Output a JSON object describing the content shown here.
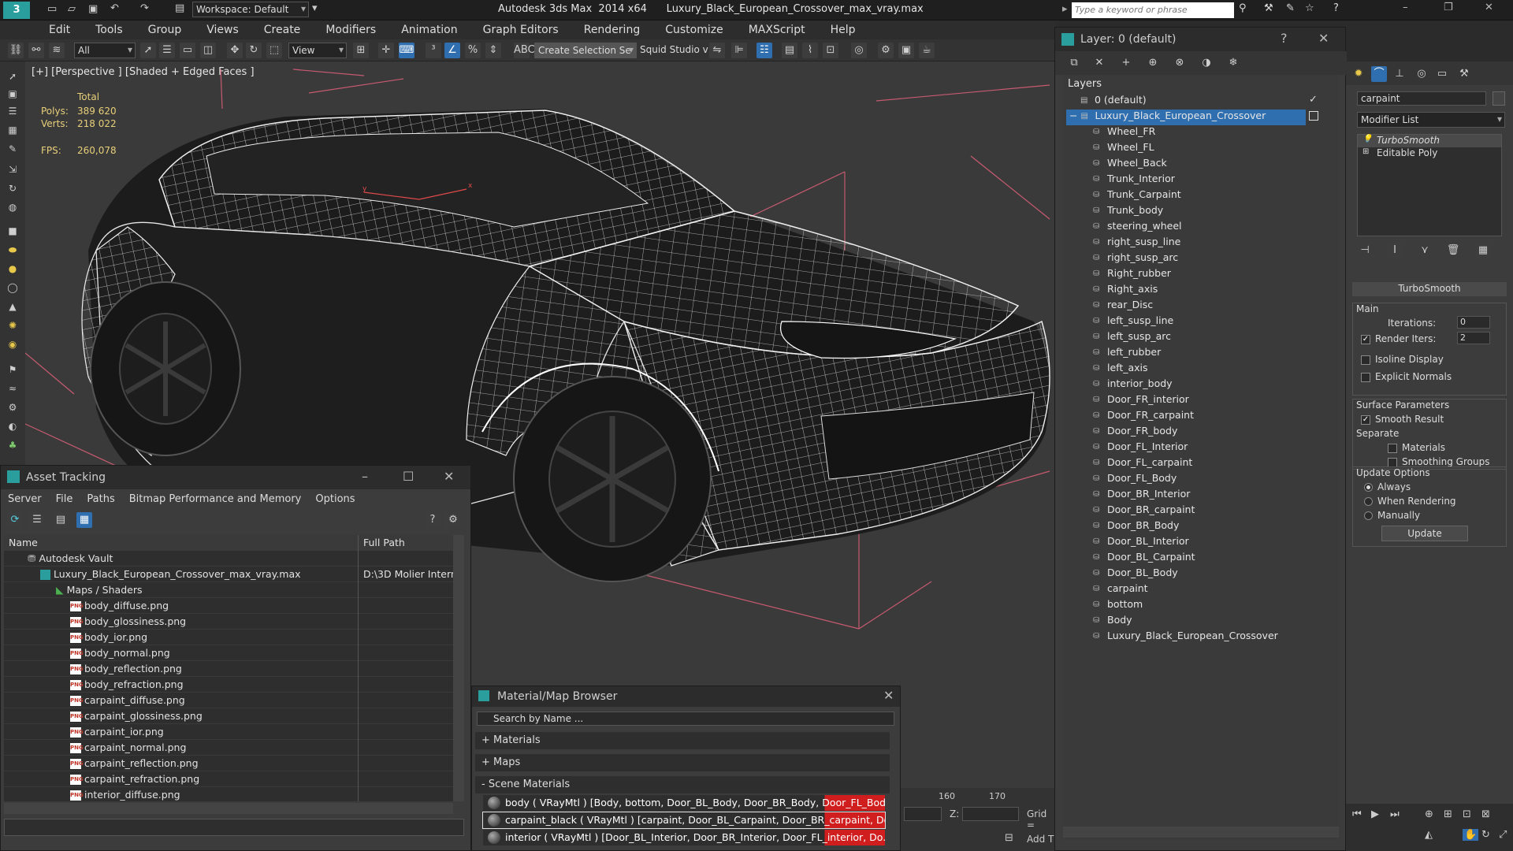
{
  "app": {
    "workspace_label": "Workspace: Default",
    "title": "Autodesk 3ds Max  2014 x64      Luxury_Black_European_Crossover_max_vray.max",
    "search_placeholder": "Type a keyword or phrase"
  },
  "menu": [
    "Edit",
    "Tools",
    "Group",
    "Views",
    "Create",
    "Modifiers",
    "Animation",
    "Graph Editors",
    "Rendering",
    "Customize",
    "MAXScript",
    "Help"
  ],
  "toolbar": {
    "selection_filter": "All",
    "ref_coord": "View",
    "selection_set": "Create Selection Se",
    "squid": "Squid Studio v"
  },
  "viewport": {
    "label": "[+] [Perspective ] [Shaded + Edged Faces ]",
    "stats": {
      "total_label": "Total",
      "polys_label": "Polys:",
      "polys_value": "389 620",
      "verts_label": "Verts:",
      "verts_value": "218 022",
      "fps_label": "FPS:",
      "fps_value": "260,078"
    }
  },
  "asset_tracking": {
    "title": "Asset Tracking",
    "menu": [
      "Server",
      "File",
      "Paths",
      "Bitmap Performance and Memory",
      "Options"
    ],
    "col_name": "Name",
    "col_path": "Full Path",
    "vault": "Autodesk Vault",
    "max_file": "Luxury_Black_European_Crossover_max_vray.max",
    "max_file_path": "D:\\3D Molier Intern",
    "maps_folder": "Maps / Shaders",
    "files": [
      "body_diffuse.png",
      "body_glossiness.png",
      "body_ior.png",
      "body_normal.png",
      "body_reflection.png",
      "body_refraction.png",
      "carpaint_diffuse.png",
      "carpaint_glossiness.png",
      "carpaint_ior.png",
      "carpaint_normal.png",
      "carpaint_reflection.png",
      "carpaint_refraction.png",
      "interior_diffuse.png"
    ],
    "png_tag": "PNG"
  },
  "material_browser": {
    "title": "Material/Map Browser",
    "search_placeholder": "Search by Name ...",
    "sections": [
      "+ Materials",
      "+ Maps",
      "- Scene Materials"
    ],
    "materials": [
      "body ( VRayMtl ) [Body, bottom, Door_BL_Body, Door_BR_Body, Door_FL_Bod...",
      "carpaint_black ( VRayMtl ) [carpaint, Door_BL_Carpaint, Door_BR_carpaint, Do...",
      "interior ( VRayMtl ) [Door_BL_Interior, Door_BR_Interior, Door_FL_interior, Do..."
    ]
  },
  "layers": {
    "title": "Layer: 0 (default)",
    "header": "Layers",
    "default_layer": "0 (default)",
    "active_layer": "Luxury_Black_European_Crossover",
    "objects": [
      "Wheel_FR",
      "Wheel_FL",
      "Wheel_Back",
      "Trunk_Interior",
      "Trunk_Carpaint",
      "Trunk_body",
      "steering_wheel",
      "right_susp_line",
      "right_susp_arc",
      "Right_rubber",
      "Right_axis",
      "rear_Disc",
      "left_susp_line",
      "left_susp_arc",
      "left_rubber",
      "left_axis",
      "interior_body",
      "Door_FR_interior",
      "Door_FR_carpaint",
      "Door_FR_body",
      "Door_FL_Interior",
      "Door_FL_carpaint",
      "Door_FL_Body",
      "Door_BR_Interior",
      "Door_BR_carpaint",
      "Door_BR_Body",
      "Door_BL_Interior",
      "Door_BL_Carpaint",
      "Door_BL_Body",
      "carpaint",
      "bottom",
      "Body",
      "Luxury_Black_European_Crossover"
    ]
  },
  "command_panel": {
    "object_name": "carpaint",
    "modifier_list": "Modifier List",
    "stack": [
      "TurboSmooth",
      "Editable Poly"
    ],
    "rollout": "TurboSmooth",
    "main": "Main",
    "iterations_label": "Iterations:",
    "iterations_value": "0",
    "render_iters_label": "Render Iters:",
    "render_iters_value": "2",
    "isoline": "Isoline Display",
    "explicit": "Explicit Normals",
    "surface_params": "Surface Parameters",
    "smooth_result": "Smooth Result",
    "separate": "Separate",
    "materials": "Materials",
    "smoothing_groups": "Smoothing Groups",
    "update_options": "Update Options",
    "always": "Always",
    "when_rendering": "When Rendering",
    "manually": "Manually",
    "update_btn": "Update"
  },
  "timeline": {
    "tick1": "160",
    "tick2": "170",
    "z_label": "Z:",
    "grid_label": "Grid =",
    "add_t": "Add T"
  }
}
